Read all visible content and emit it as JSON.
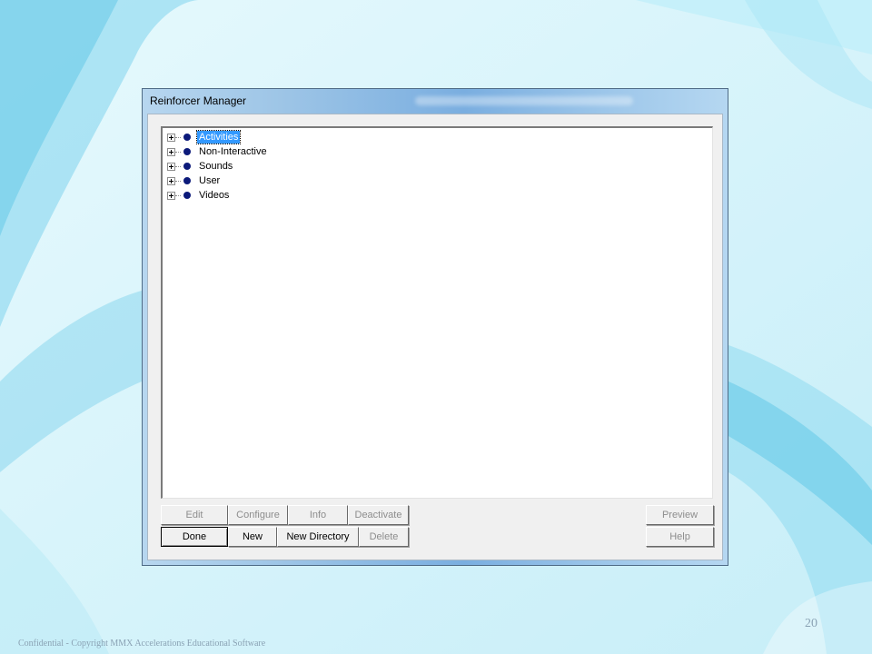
{
  "window": {
    "title": "Reinforcer Manager"
  },
  "tree": {
    "items": [
      {
        "label": "Activities",
        "selected": true
      },
      {
        "label": "Non-Interactive",
        "selected": false
      },
      {
        "label": "Sounds",
        "selected": false
      },
      {
        "label": "User",
        "selected": false
      },
      {
        "label": "Videos",
        "selected": false
      }
    ]
  },
  "buttons": {
    "edit": "Edit",
    "configure": "Configure",
    "info": "Info",
    "deactivate": "Deactivate",
    "preview": "Preview",
    "done": "Done",
    "new": "New",
    "new_directory": "New Directory",
    "delete": "Delete",
    "help": "Help"
  },
  "slide": {
    "footer": "Confidential - Copyright MMX Accelerations Educational Software",
    "page_number": "20"
  },
  "colors": {
    "selection": "#3399ff",
    "node_bullet": "#0c1a7a",
    "background": "#d8f4fb"
  }
}
